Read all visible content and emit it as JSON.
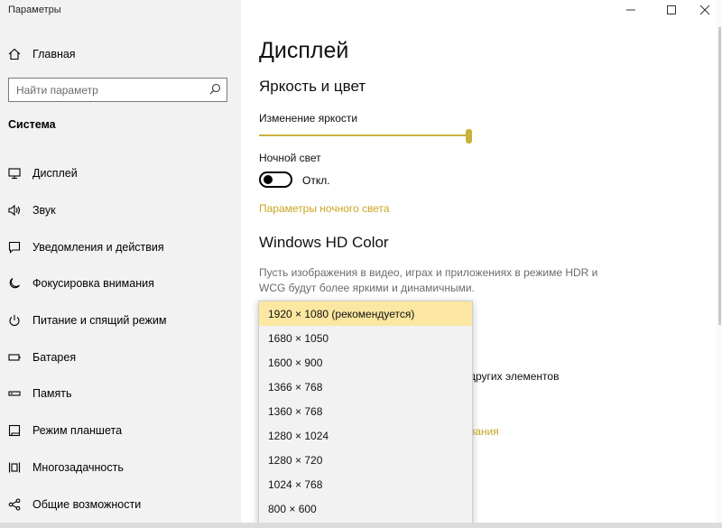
{
  "app_title": "Параметры",
  "home_label": "Главная",
  "search": {
    "placeholder": "Найти параметр",
    "value": ""
  },
  "section_title": "Система",
  "nav": [
    {
      "label": "Дисплей",
      "icon": "monitor-icon"
    },
    {
      "label": "Звук",
      "icon": "speaker-icon"
    },
    {
      "label": "Уведомления и действия",
      "icon": "notification-icon"
    },
    {
      "label": "Фокусировка внимания",
      "icon": "moon-icon"
    },
    {
      "label": "Питание и спящий режим",
      "icon": "power-icon"
    },
    {
      "label": "Батарея",
      "icon": "battery-icon"
    },
    {
      "label": "Память",
      "icon": "storage-icon"
    },
    {
      "label": "Режим планшета",
      "icon": "tablet-icon"
    },
    {
      "label": "Многозадачность",
      "icon": "multitask-icon"
    },
    {
      "label": "Общие возможности",
      "icon": "share-icon"
    }
  ],
  "main": {
    "title": "Дисплей",
    "brightness_section": "Яркость и цвет",
    "brightness_label": "Изменение яркости",
    "brightness_value_percent": 100,
    "night_light_label": "Ночной свет",
    "night_light_state": "Откл.",
    "night_light_link": "Параметры ночного света",
    "hdr_section": "Windows HD Color",
    "hdr_desc": "Пусть изображения в видео, играх и приложениях в режиме HDR и WCG будут более яркими и динамичными.",
    "partial_text_1": "других элементов",
    "partial_link_1": "вания"
  },
  "resolution_options": [
    "1920 × 1080 (рекомендуется)",
    "1680 × 1050",
    "1600 × 900",
    "1366 × 768",
    "1360 × 768",
    "1280 × 1024",
    "1280 × 720",
    "1024 × 768",
    "800 × 600"
  ],
  "selected_resolution_index": 0,
  "colors": {
    "accent": "#c9b13a",
    "link": "#c9a623",
    "selected_bg": "#fbe7a1",
    "sidebar_bg": "#f2f2f2"
  }
}
